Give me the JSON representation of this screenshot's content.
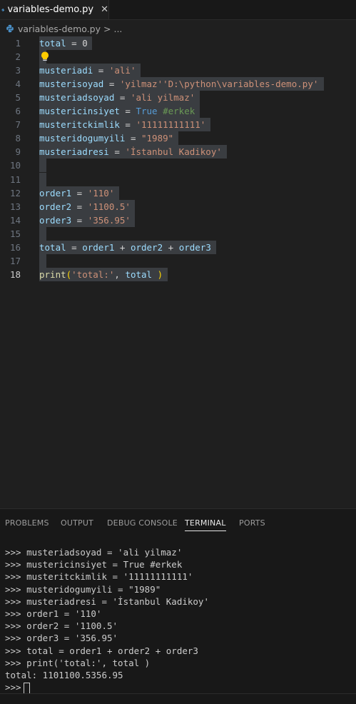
{
  "tab": {
    "label": "variables-demo.py",
    "close": "✕"
  },
  "breadcrumb": {
    "file": "variables-demo.py",
    "sep": ">",
    "more": "..."
  },
  "editor": {
    "lines": [
      {
        "n": "1",
        "tokens": [
          [
            "v",
            "total"
          ],
          [
            "p",
            " = "
          ],
          [
            "p",
            "0"
          ]
        ]
      },
      {
        "n": "2",
        "tokens": []
      },
      {
        "n": "3",
        "tokens": [
          [
            "v",
            "musteriadi"
          ],
          [
            "p",
            " = "
          ],
          [
            "s",
            "'ali'"
          ]
        ]
      },
      {
        "n": "4",
        "tokens": [
          [
            "v",
            "musterisoyad"
          ],
          [
            "p",
            " = "
          ],
          [
            "s",
            "'yilmaz''D:\\python\\variables-demo.py'"
          ]
        ]
      },
      {
        "n": "5",
        "tokens": [
          [
            "v",
            "musteriadsoyad"
          ],
          [
            "p",
            " = "
          ],
          [
            "s",
            "'ali yilmaz'"
          ]
        ]
      },
      {
        "n": "6",
        "tokens": [
          [
            "v",
            "mustericinsiyet"
          ],
          [
            "p",
            " = "
          ],
          [
            "k",
            "True"
          ],
          [
            "p",
            " "
          ],
          [
            "c",
            "#erkek"
          ]
        ]
      },
      {
        "n": "7",
        "tokens": [
          [
            "v",
            "musteritckimlik"
          ],
          [
            "p",
            " = "
          ],
          [
            "s",
            "'11111111111'"
          ]
        ]
      },
      {
        "n": "8",
        "tokens": [
          [
            "v",
            "musteridogumyili"
          ],
          [
            "p",
            " = "
          ],
          [
            "s",
            "\"1989\""
          ]
        ]
      },
      {
        "n": "9",
        "tokens": [
          [
            "v",
            "musteriadresi"
          ],
          [
            "p",
            " = "
          ],
          [
            "s",
            "'İstanbul Kadikoy'"
          ]
        ]
      },
      {
        "n": "10",
        "tokens": []
      },
      {
        "n": "11",
        "tokens": []
      },
      {
        "n": "12",
        "tokens": [
          [
            "v",
            "order1"
          ],
          [
            "p",
            " = "
          ],
          [
            "s",
            "'110'"
          ]
        ]
      },
      {
        "n": "13",
        "tokens": [
          [
            "v",
            "order2"
          ],
          [
            "p",
            " = "
          ],
          [
            "s",
            "'1100.5'"
          ]
        ]
      },
      {
        "n": "14",
        "tokens": [
          [
            "v",
            "order3"
          ],
          [
            "p",
            " = "
          ],
          [
            "s",
            "'356.95'"
          ]
        ]
      },
      {
        "n": "15",
        "tokens": []
      },
      {
        "n": "16",
        "tokens": [
          [
            "v",
            "total"
          ],
          [
            "p",
            " = "
          ],
          [
            "v",
            "order1"
          ],
          [
            "p",
            " + "
          ],
          [
            "v",
            "order2"
          ],
          [
            "p",
            " + "
          ],
          [
            "v",
            "order3"
          ]
        ]
      },
      {
        "n": "17",
        "tokens": []
      },
      {
        "n": "18",
        "tokens": [
          [
            "f",
            "print"
          ],
          [
            "br",
            "("
          ],
          [
            "s",
            "'total:'"
          ],
          [
            "p",
            ", "
          ],
          [
            "v",
            "total"
          ],
          [
            "p",
            " "
          ],
          [
            "br",
            ")"
          ]
        ]
      }
    ]
  },
  "panel": {
    "tabs": [
      "PROBLEMS",
      "OUTPUT",
      "DEBUG CONSOLE",
      "TERMINAL",
      "PORTS"
    ],
    "active_tab": "TERMINAL",
    "terminal_lines": [
      ">>> musteriadsoyad = 'ali yilmaz'",
      ">>> mustericinsiyet = True #erkek",
      ">>> musteritckimlik = '11111111111'",
      ">>> musteridogumyili = \"1989\"",
      ">>> musteriadresi = 'İstanbul Kadikoy'",
      ">>> order1 = '110'",
      ">>> order2 = '1100.5'",
      ">>> order3 = '356.95'",
      ">>> total = order1 + order2 + order3",
      ">>> print('total:', total )",
      "total: 1101100.5356.95"
    ],
    "prompt": ">>>"
  },
  "colors": {
    "variable": "#9cdcfe",
    "string": "#ce9178",
    "keyword": "#569cd6",
    "comment": "#6a9955",
    "function": "#dcdcaa",
    "selection": "#3a3d41"
  }
}
